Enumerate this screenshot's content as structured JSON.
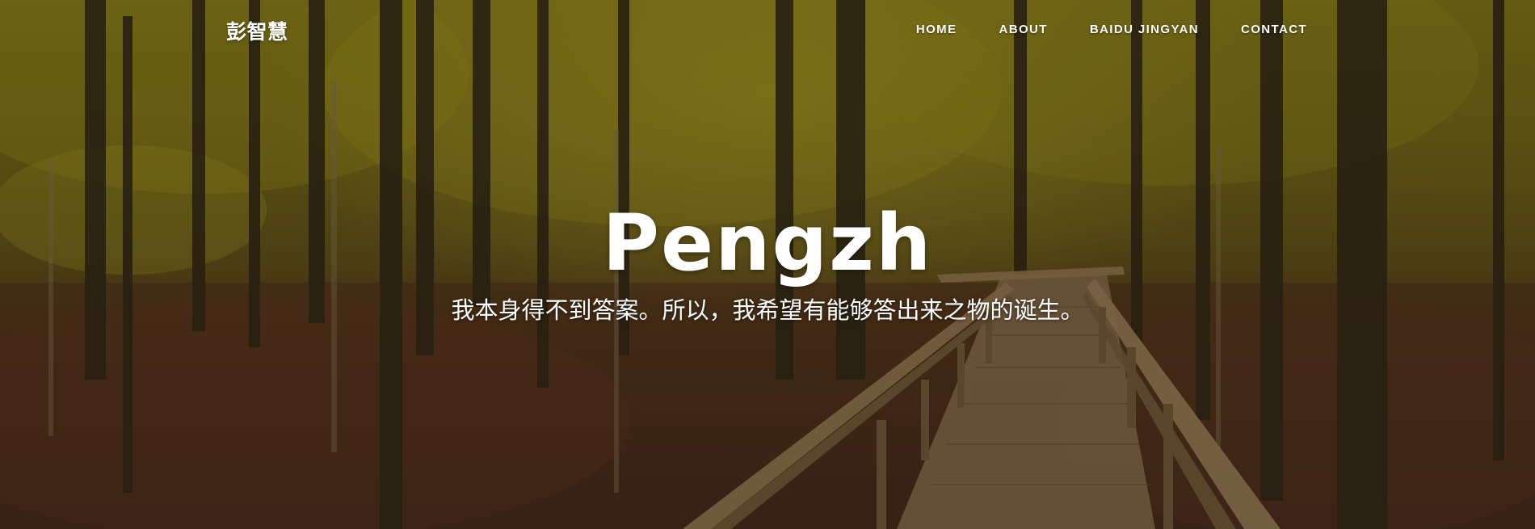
{
  "navbar": {
    "brand": "彭智慧",
    "links": [
      "HOME",
      "ABOUT",
      "BAIDU JINGYAN",
      "CONTACT"
    ]
  },
  "hero": {
    "title": "Pengzh",
    "subtitle": "我本身得不到答案。所以，我希望有能够答出来之物的诞生。"
  },
  "theme": {
    "text_color": "#ffffff",
    "foliage_color": "#8a7a18",
    "forest_floor_color": "#4a2a1a",
    "boardwalk_color": "#7a6040"
  }
}
